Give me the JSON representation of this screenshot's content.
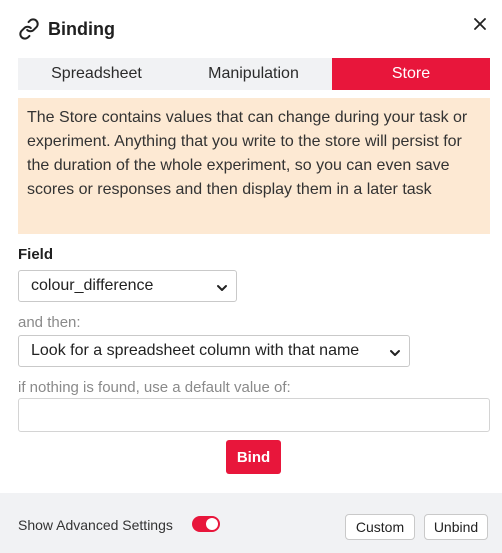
{
  "header": {
    "title": "Binding",
    "icon": "link-icon",
    "close_icon": "close-icon"
  },
  "tabs": [
    {
      "label": "Spreadsheet",
      "active": false
    },
    {
      "label": "Manipulation",
      "active": false
    },
    {
      "label": "Store",
      "active": true
    }
  ],
  "info": {
    "text": "The Store contains values that can change during your task or experiment. Anything that you write to the store will persist for the duration of the whole experiment, so you can even save scores or responses and then display them in a later task"
  },
  "field": {
    "label": "Field",
    "selected": "colour_difference"
  },
  "then": {
    "label": "and then:",
    "selected": "Look for a spreadsheet column with that name"
  },
  "default_value": {
    "label": "if nothing is found, use a default value of:",
    "value": ""
  },
  "bind_label": "Bind",
  "footer": {
    "advanced_label": "Show Advanced Settings",
    "advanced_enabled": true,
    "custom_label": "Custom",
    "unbind_label": "Unbind"
  },
  "colors": {
    "accent": "#e8163b",
    "info_bg": "#fde9d3",
    "footer_bg": "#f1f2f4"
  }
}
